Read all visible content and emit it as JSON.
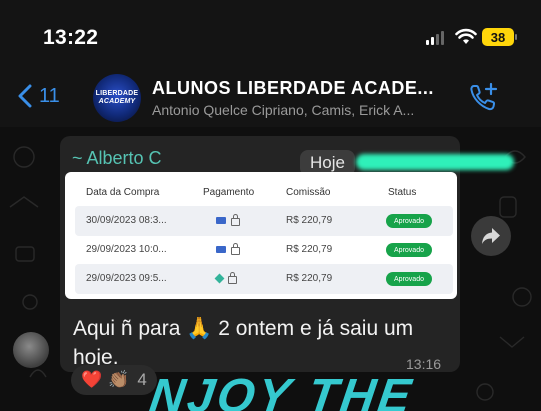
{
  "status_bar": {
    "time": "13:22",
    "battery": "38"
  },
  "header": {
    "back_count": "11",
    "avatar_line1": "LIBERDADE",
    "avatar_line2": "ACADEMY",
    "title": "ALUNOS LIBERDADE ACADE...",
    "members": "Antonio Quelce Cipriano, Camis, Erick A..."
  },
  "message": {
    "sender": "~ Alberto C",
    "date_label": "Hoje",
    "text": "Aqui ñ para 🙏 2 ontem e já saiu um hoje.",
    "time": "13:16",
    "reactions": {
      "heart": "❤️",
      "clap": "👏🏽",
      "count": "4"
    }
  },
  "screenshot": {
    "columns": [
      "Data da Compra",
      "Pagamento",
      "Comissão",
      "Status"
    ],
    "rows": [
      {
        "date": "30/09/2023 08:3...",
        "payment": "card",
        "commission": "R$ 220,79",
        "status": "Aprovado"
      },
      {
        "date": "29/09/2023 10:0...",
        "payment": "card",
        "commission": "R$ 220,79",
        "status": "Aprovado"
      },
      {
        "date": "29/09/2023 09:5...",
        "payment": "pix",
        "commission": "R$ 220,79",
        "status": "Aprovado"
      }
    ]
  },
  "background_text": "NJOY THE",
  "colors": {
    "accent": "#3a8fe8",
    "sender": "#56c3b3",
    "approved": "#17a34a",
    "battery": "#ffd60a"
  }
}
